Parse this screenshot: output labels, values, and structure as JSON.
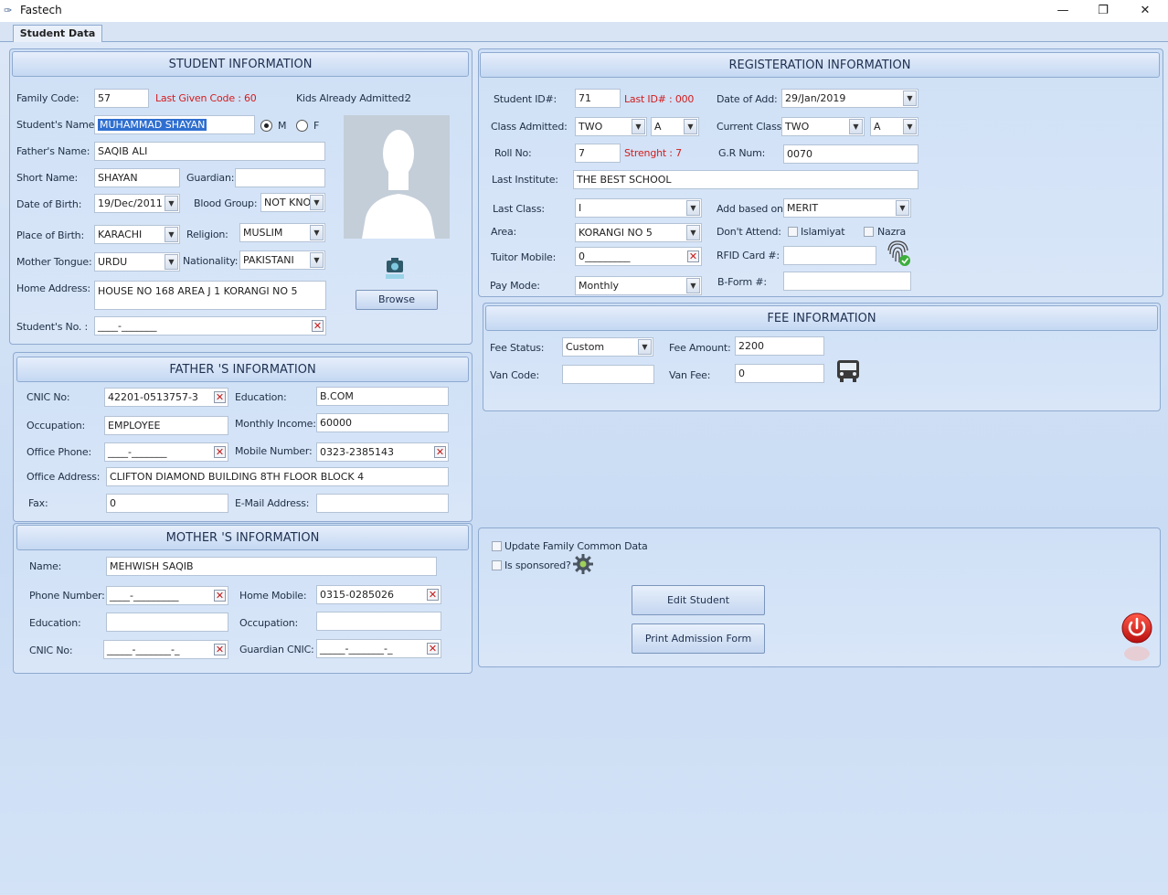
{
  "app": {
    "title": "Fastech",
    "minimize": "—",
    "restore": "❐",
    "close": "✕"
  },
  "tabs": [
    "Student Data"
  ],
  "student": {
    "header": "STUDENT INFORMATION",
    "family_code_label": "Family Code:",
    "family_code": "57",
    "last_given_code_label": "Last Given Code : 60",
    "kids_admitted_label": "Kids Already Admitted:",
    "kids_admitted": "2",
    "name_label": "Student's Name:",
    "name": "MUHAMMAD SHAYAN",
    "gender_m": "M",
    "gender_f": "F",
    "father_name_label": "Father's Name:",
    "father_name": "SAQIB ALI",
    "short_name_label": "Short Name:",
    "short_name": "SHAYAN",
    "guardian_label": "Guardian:",
    "guardian": "",
    "dob_label": "Date of Birth:",
    "dob": "19/Dec/2011",
    "blood_group_label": "Blood Group:",
    "blood_group": "NOT KNO",
    "pob_label": "Place of Birth:",
    "pob": "KARACHI",
    "religion_label": "Religion:",
    "religion": "MUSLIM",
    "mother_tongue_label": "Mother Tongue:",
    "mother_tongue": "URDU",
    "nationality_label": "Nationality:",
    "nationality": "PAKISTANI",
    "home_address_label": "Home Address:",
    "home_address": "HOUSE NO 168 AREA J 1 KORANGI NO 5",
    "student_no_label": "Student's No. :",
    "student_no": "____-_______",
    "browse": "Browse"
  },
  "father": {
    "header": "FATHER 'S INFORMATION",
    "cnic_label": "CNIC No:",
    "cnic": "42201-0513757-3",
    "education_label": "Education:",
    "education": "B.COM",
    "occupation_label": "Occupation:",
    "occupation": "EMPLOYEE",
    "income_label": "Monthly Income:",
    "income": "60000",
    "office_phone_label": "Office Phone:",
    "office_phone": "____-_______",
    "mobile_label": "Mobile Number:",
    "mobile": "0323-2385143",
    "office_address_label": "Office Address:",
    "office_address": "CLIFTON DIAMOND BUILDING  8TH FLOOR BLOCK 4",
    "fax_label": "Fax:",
    "fax": "0",
    "email_label": "E-Mail Address:",
    "email": ""
  },
  "mother": {
    "header": "MOTHER 'S INFORMATION",
    "name_label": "Name:",
    "name": "MEHWISH SAQIB",
    "phone_label": "Phone Number:",
    "phone": "____-_________",
    "home_mobile_label": "Home Mobile:",
    "home_mobile": "0315-0285026",
    "education_label": "Education:",
    "education": "",
    "occupation_label": "Occupation:",
    "occupation": "",
    "cnic_label": "CNIC No:",
    "cnic": "_____-_______-_",
    "guardian_cnic_label": "Guardian CNIC:",
    "guardian_cnic": "_____-_______-_"
  },
  "registration": {
    "header": "REGISTERATION INFORMATION",
    "student_id_label": "Student ID#:",
    "student_id": "71",
    "last_id_label": "Last ID# : 000",
    "date_of_add_label": "Date of Add:",
    "date_of_add": "29/Jan/2019",
    "class_admitted_label": "Class Admitted:",
    "class_admitted": "TWO",
    "class_admitted_section": "A",
    "current_class_label": "Current Class:",
    "current_class": "TWO",
    "current_class_section": "A",
    "roll_no_label": "Roll No:",
    "roll_no": "7",
    "strength_label": "Strenght : 7",
    "gr_num_label": "G.R Num:",
    "gr_num": "0070",
    "last_institute_label": "Last Institute:",
    "last_institute": "THE BEST SCHOOL",
    "last_class_label": "Last Class:",
    "last_class": "I",
    "add_based_on_label": "Add based on:",
    "add_based_on": "MERIT",
    "area_label": "Area:",
    "area": "KORANGI NO 5",
    "dont_attend_label": "Don't Attend:",
    "islamiyat": "Islamiyat",
    "nazra": "Nazra",
    "tuitor_mobile_label": "Tuitor Mobile:",
    "tuitor_mobile": "0_________",
    "rfid_label": "RFID Card #:",
    "rfid": "",
    "pay_mode_label": "Pay Mode:",
    "pay_mode": "Monthly",
    "bform_label": "B-Form #:",
    "bform": ""
  },
  "fee": {
    "header": "FEE INFORMATION",
    "status_label": "Fee Status:",
    "status": "Custom",
    "amount_label": "Fee Amount:",
    "amount": "2200",
    "van_code_label": "Van Code:",
    "van_code": "",
    "van_fee_label": "Van Fee:",
    "van_fee": "0"
  },
  "actions": {
    "update_family": "Update Family Common Data",
    "is_sponsored": "Is sponsored?",
    "edit_student": "Edit Student",
    "print_form": "Print Admission Form"
  }
}
